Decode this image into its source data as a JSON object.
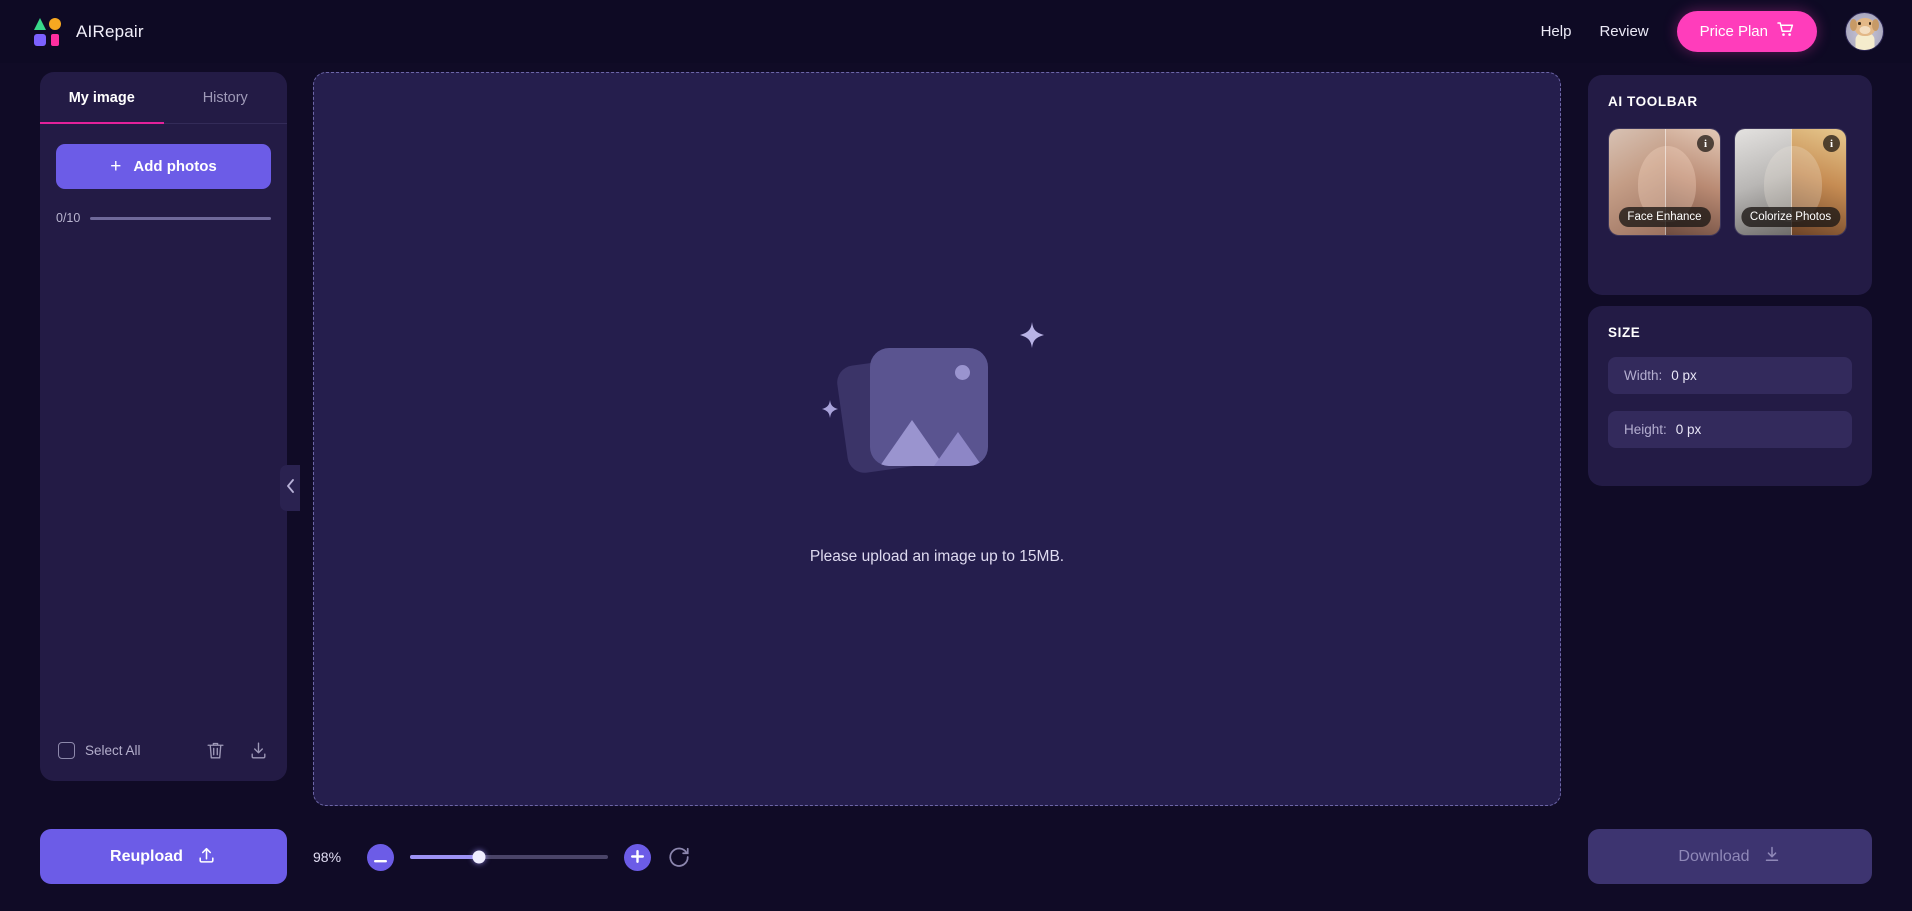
{
  "header": {
    "brand": "AIRepair",
    "logo_icon": "logo-blocks-icon",
    "nav": [
      {
        "label": "Help",
        "name": "help"
      },
      {
        "label": "Review",
        "name": "review"
      }
    ],
    "price_plan": {
      "label": "Price Plan",
      "icon": "cart-icon"
    },
    "avatar_icon": "user-avatar-dog"
  },
  "sidebar": {
    "tabs": [
      {
        "label": "My image",
        "active": true
      },
      {
        "label": "History",
        "active": false
      }
    ],
    "add_photos": {
      "label": "Add photos",
      "icon": "plus-icon"
    },
    "counter": {
      "label": "0/10",
      "value": 0,
      "max": 10,
      "fill_percent": "0%"
    },
    "select_all": {
      "label": "Select All",
      "checked": false
    },
    "footer_icons": [
      {
        "name": "trash-icon"
      },
      {
        "name": "download-icon"
      }
    ],
    "collapse_icon": "chevron-left-icon",
    "reupload": {
      "label": "Reupload",
      "icon": "upload-icon"
    }
  },
  "canvas": {
    "message": "Please upload an image up to 15MB.",
    "placeholder_icon": "image-placeholder-icon"
  },
  "zoombar": {
    "percent": "98%",
    "zoom_out_icon": "minus-icon",
    "zoom_in_icon": "plus-icon",
    "reset_icon": "reset-rotate-icon",
    "slider_value": 35,
    "slider_fill": "35%"
  },
  "ai_toolbar": {
    "title": "AI TOOLBAR",
    "tools": [
      {
        "label": "Face Enhance",
        "info_icon": "info-icon"
      },
      {
        "label": "Colorize Photos",
        "info_icon": "info-icon"
      }
    ]
  },
  "size_panel": {
    "title": "SIZE",
    "fields": [
      {
        "key": "Width:",
        "value": "0 px"
      },
      {
        "key": "Height:",
        "value": "0 px"
      }
    ]
  },
  "download": {
    "label": "Download",
    "icon": "download-icon",
    "enabled": false
  },
  "colors": {
    "page_bg": "#100b26",
    "panel_bg": "#231b45",
    "canvas_bg": "#251e4d",
    "accent_purple": "#6c5ce7",
    "accent_pink": "#ff3dbb",
    "tab_underline": "#e3219b"
  }
}
